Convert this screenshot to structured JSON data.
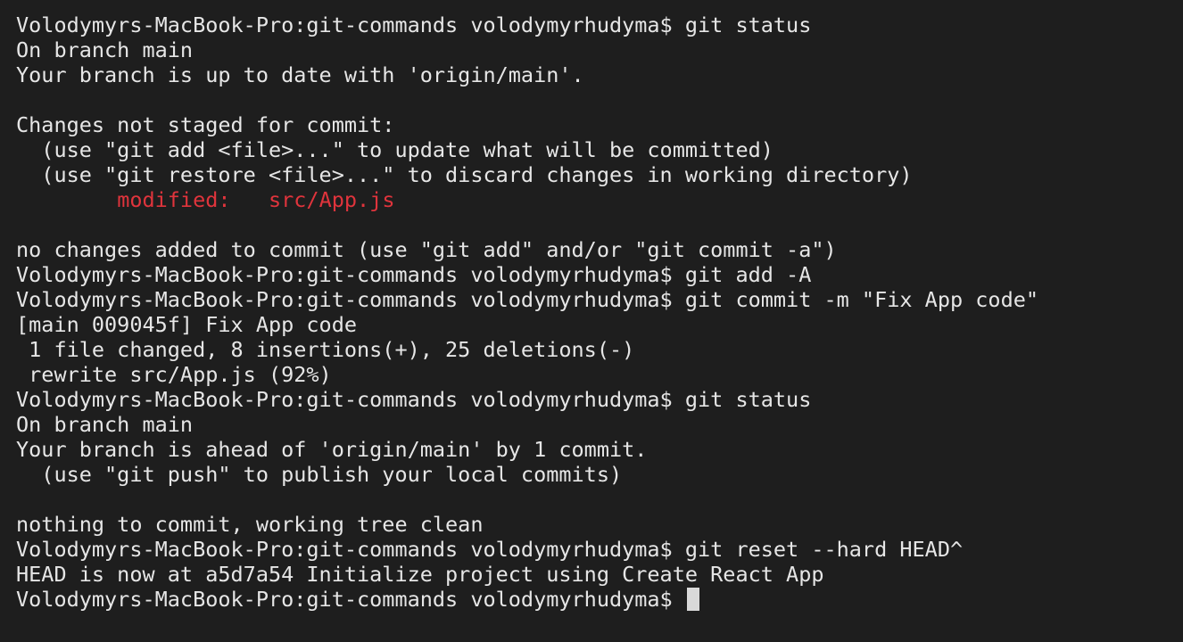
{
  "terminal": {
    "prompt": "Volodymyrs-MacBook-Pro:git-commands volodymyrhudyma$ ",
    "modified_label": "modified:",
    "modified_file": "src/App.js",
    "lines": [
      "git status",
      "On branch main",
      "Your branch is up to date with 'origin/main'.",
      "",
      "Changes not staged for commit:",
      "  (use \"git add <file>...\" to update what will be committed)",
      "  (use \"git restore <file>...\" to discard changes in working directory)",
      "",
      "",
      "no changes added to commit (use \"git add\" and/or \"git commit -a\")",
      "git add -A",
      "git commit -m \"Fix App code\"",
      "[main 009045f] Fix App code",
      " 1 file changed, 8 insertions(+), 25 deletions(-)",
      " rewrite src/App.js (92%)",
      "git status",
      "On branch main",
      "Your branch is ahead of 'origin/main' by 1 commit.",
      "  (use \"git push\" to publish your local commits)",
      "",
      "nothing to commit, working tree clean",
      "git reset --hard HEAD^",
      "HEAD is now at a5d7a54 Initialize project using Create React App"
    ]
  },
  "colors": {
    "background": "#1e1e1e",
    "text": "#e6e6e6",
    "modified": "#e0343c",
    "cursor": "#d9d9d9"
  }
}
